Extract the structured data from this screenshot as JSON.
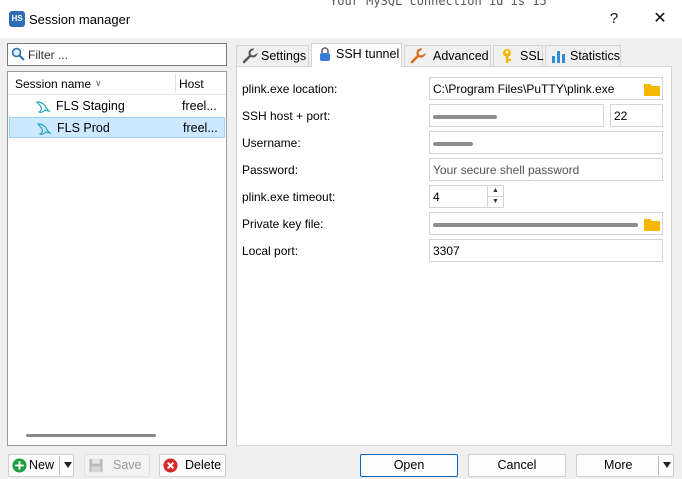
{
  "background_console_text": "Your MySQL connection id is 15",
  "window": {
    "title": "Session manager",
    "app_icon_text": "HS",
    "help_label": "?",
    "close_label": "✕"
  },
  "filter": {
    "placeholder": "Filter ..."
  },
  "sessions": {
    "columns": [
      "Session name",
      "Host"
    ],
    "rows": [
      {
        "name": "FLS Staging",
        "host": "freel...",
        "icon": "dolphin-icon",
        "selected": false
      },
      {
        "name": "FLS Prod",
        "host": "freel...",
        "icon": "dolphin-icon",
        "selected": true
      }
    ]
  },
  "tabs": [
    {
      "label": "Settings",
      "icon": "wrench-icon",
      "active": false
    },
    {
      "label": "SSH tunnel",
      "icon": "lock-icon",
      "active": true
    },
    {
      "label": "Advanced",
      "icon": "wrench-icon",
      "active": false
    },
    {
      "label": "SSL",
      "icon": "key-icon",
      "active": false
    },
    {
      "label": "Statistics",
      "icon": "bar-chart-icon",
      "active": false
    }
  ],
  "ssh_form": {
    "plink_location": {
      "label": "plink.exe location:",
      "value": "C:\\Program Files\\PuTTY\\plink.exe"
    },
    "host_port": {
      "label": "SSH host + port:",
      "port": "22"
    },
    "username": {
      "label": "Username:"
    },
    "password": {
      "label": "Password:",
      "placeholder": "Your secure shell password"
    },
    "timeout": {
      "label": "plink.exe timeout:",
      "value": "4"
    },
    "private_key": {
      "label": "Private key file:"
    },
    "local_port": {
      "label": "Local port:",
      "value": "3307"
    }
  },
  "buttons": {
    "new": "New",
    "save": "Save",
    "delete": "Delete",
    "open": "Open",
    "cancel": "Cancel",
    "more": "More"
  },
  "colors": {
    "accent": "#0067c0",
    "selection": "#cce8ff",
    "folder": "#f5b700",
    "dolphin": "#2aa3c4",
    "new_green": "#1e9e3e",
    "delete_red": "#d62b2b",
    "key_yellow": "#f2b705",
    "wrench_orange": "#d96b1c",
    "lock_blue": "#3a7bd5",
    "chart_blue": "#2f8fd6"
  }
}
